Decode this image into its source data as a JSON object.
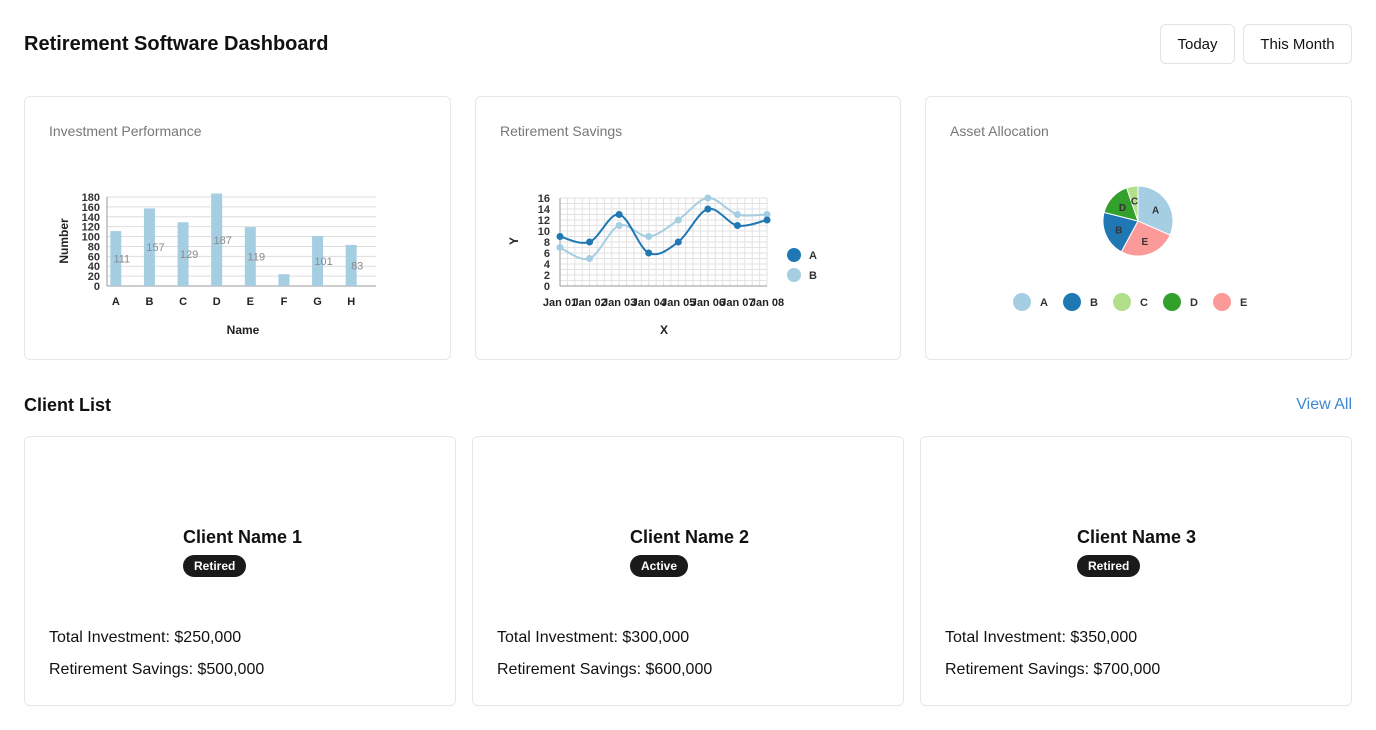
{
  "header": {
    "title": "Retirement Software Dashboard",
    "buttons": {
      "today": "Today",
      "this_month": "This Month"
    }
  },
  "charts": {
    "investment": {
      "title": "Investment Performance"
    },
    "savings": {
      "title": "Retirement Savings"
    },
    "allocation": {
      "title": "Asset Allocation"
    }
  },
  "chart_data": [
    {
      "type": "bar",
      "title": "Investment Performance",
      "xlabel": "Name",
      "ylabel": "Number",
      "categories": [
        "A",
        "B",
        "C",
        "D",
        "E",
        "F",
        "G",
        "H"
      ],
      "values": [
        111,
        157,
        129,
        187,
        119,
        24,
        101,
        83
      ],
      "data_labels": [
        "111",
        "157",
        "129",
        "187",
        "119",
        "",
        "101",
        "83"
      ],
      "ylim": [
        0,
        180
      ],
      "yticks": [
        0,
        20,
        40,
        60,
        80,
        100,
        120,
        140,
        160,
        180
      ],
      "grid": true,
      "color": "#a6cee3"
    },
    {
      "type": "line",
      "title": "Retirement Savings",
      "xlabel": "X",
      "ylabel": "Y",
      "x": [
        "Jan 01",
        "Jan 02",
        "Jan 03",
        "Jan 04",
        "Jan 05",
        "Jan 06",
        "Jan 07",
        "Jan 08"
      ],
      "series": [
        {
          "name": "A",
          "values": [
            9,
            8,
            13,
            6,
            8,
            14,
            11,
            12
          ],
          "color": "#1f78b4"
        },
        {
          "name": "B",
          "values": [
            7,
            5,
            11,
            9,
            12,
            16,
            13,
            13
          ],
          "color": "#a6cee3"
        }
      ],
      "ylim": [
        0,
        16
      ],
      "yticks": [
        0,
        2,
        4,
        6,
        8,
        10,
        12,
        14,
        16
      ],
      "grid": true,
      "legend": "right"
    },
    {
      "type": "pie",
      "title": "Asset Allocation",
      "labels": [
        "A",
        "E",
        "B",
        "D",
        "C"
      ],
      "values": [
        30,
        25,
        20,
        15,
        5
      ],
      "colors": [
        "#a6cee3",
        "#fb9a99",
        "#1f78b4",
        "#33a02c",
        "#b2df8a"
      ],
      "legend_order": [
        {
          "name": "A",
          "color": "#a6cee3"
        },
        {
          "name": "B",
          "color": "#1f78b4"
        },
        {
          "name": "C",
          "color": "#b2df8a"
        },
        {
          "name": "D",
          "color": "#33a02c"
        },
        {
          "name": "E",
          "color": "#fb9a99"
        }
      ],
      "legend": "bottom"
    }
  ],
  "clients": {
    "title": "Client List",
    "view_all": "View All",
    "items": [
      {
        "name": "Client Name 1",
        "status": "Retired",
        "investment": "Total Investment: $250,000",
        "savings": "Retirement Savings: $500,000"
      },
      {
        "name": "Client Name 2",
        "status": "Active",
        "investment": "Total Investment: $300,000",
        "savings": "Retirement Savings: $600,000"
      },
      {
        "name": "Client Name 3",
        "status": "Retired",
        "investment": "Total Investment: $350,000",
        "savings": "Retirement Savings: $700,000"
      }
    ]
  },
  "colors": {
    "accent_link": "#3f86d0",
    "badge_bg": "#1a1a1a"
  }
}
